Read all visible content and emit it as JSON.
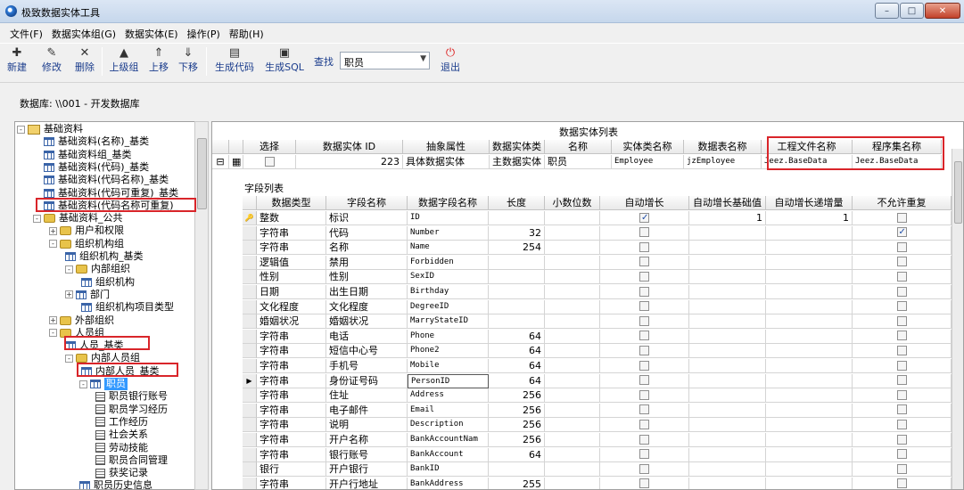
{
  "window": {
    "title": "极致数据实体工具"
  },
  "menu": [
    "文件(F)",
    "数据实体组(G)",
    "数据实体(E)",
    "操作(P)",
    "帮助(H)"
  ],
  "toolbar": {
    "new": "新建",
    "edit": "修改",
    "delete": "删除",
    "parent_group": "上级组",
    "move_up": "上移",
    "move_down": "下移",
    "gen_code": "生成代码",
    "gen_sql": "生成SQL",
    "find_label": "查找",
    "find_value": "职员",
    "exit": "退出"
  },
  "db_label": "数据库: \\\\001 - 开发数据库",
  "tree": [
    {
      "label": "基础资料",
      "icon": "root-icon",
      "exp": "-"
    },
    {
      "label": "基础资料(名称)_基类",
      "icon": "table-icon"
    },
    {
      "label": "基础资料组_基类",
      "icon": "table-icon"
    },
    {
      "label": "基础资料(代码)_基类",
      "icon": "table-icon"
    },
    {
      "label": "基础资料(代码名称)_基类",
      "icon": "table-icon"
    },
    {
      "label": "基础资料(代码可重复)_基类",
      "icon": "table-icon"
    },
    {
      "label": "基础资料(代码名称可重复)_",
      "icon": "table-icon"
    },
    {
      "label": "基础资料_公共",
      "icon": "folder-icon",
      "exp": "-"
    },
    {
      "label": "用户和权限",
      "icon": "folder-icon",
      "exp": "+"
    },
    {
      "label": "组织机构组",
      "icon": "folder-icon",
      "exp": "-"
    },
    {
      "label": "组织机构_基类",
      "icon": "table-icon"
    },
    {
      "label": "内部组织",
      "icon": "folder-icon",
      "exp": "-"
    },
    {
      "label": "组织机构",
      "icon": "table-icon"
    },
    {
      "label": "部门",
      "icon": "table-icon",
      "exp": "+"
    },
    {
      "label": "组织机构项目类型",
      "icon": "table-icon"
    },
    {
      "label": "外部组织",
      "icon": "folder-icon",
      "exp": "+"
    },
    {
      "label": "人员组",
      "icon": "folder-icon",
      "exp": "-"
    },
    {
      "label": "人员_基类",
      "icon": "table-icon"
    },
    {
      "label": "内部人员组",
      "icon": "folder-icon",
      "exp": "-"
    },
    {
      "label": "内部人员_基类",
      "icon": "table-icon"
    },
    {
      "label": "职员",
      "icon": "table-icon",
      "exp": "-"
    },
    {
      "label": "职员银行账号",
      "icon": "form-icon"
    },
    {
      "label": "职员学习经历",
      "icon": "form-icon"
    },
    {
      "label": "工作经历",
      "icon": "form-icon"
    },
    {
      "label": "社会关系",
      "icon": "form-icon"
    },
    {
      "label": "劳动技能",
      "icon": "form-icon"
    },
    {
      "label": "职员合同管理",
      "icon": "form-icon"
    },
    {
      "label": "获奖记录",
      "icon": "form-icon"
    },
    {
      "label": "职员历史信息",
      "icon": "table-icon"
    }
  ],
  "entity_grid": {
    "title": "数据实体列表",
    "headers": [
      "选择",
      "数据实体 ID",
      "抽象属性",
      "数据实体类",
      "名称",
      "实体类名称",
      "数据表名称",
      "工程文件名称",
      "程序集名称"
    ],
    "row": {
      "id": "223",
      "abstract": "具体数据实体",
      "entity_class": "主数据实体",
      "name": "职员",
      "class_name": "Employee",
      "table_name": "jzEmployee",
      "project_file": "Jeez.BaseData",
      "assembly": "Jeez.BaseData"
    }
  },
  "field_grid": {
    "title": "字段列表",
    "headers": [
      "数据类型",
      "字段名称",
      "数据字段名称",
      "长度",
      "小数位数",
      "自动增长",
      "自动增长基础值",
      "自动增长递增量",
      "不允许重复"
    ],
    "rows": [
      {
        "type": "整数",
        "name": "标识",
        "field": "ID",
        "len": "",
        "auto": true,
        "seed": "1",
        "step": "1",
        "uniq": false,
        "key": true
      },
      {
        "type": "字符串",
        "name": "代码",
        "field": "Number",
        "len": "32",
        "auto": false,
        "seed": "",
        "step": "",
        "uniq": true
      },
      {
        "type": "字符串",
        "name": "名称",
        "field": "Name",
        "len": "254",
        "auto": false,
        "seed": "",
        "step": "",
        "uniq": false
      },
      {
        "type": "逻辑值",
        "name": "禁用",
        "field": "Forbidden",
        "len": "",
        "auto": false,
        "seed": "",
        "step": "",
        "uniq": false
      },
      {
        "type": "性别",
        "name": "性别",
        "field": "SexID",
        "len": "",
        "auto": false,
        "seed": "",
        "step": "",
        "uniq": false
      },
      {
        "type": "日期",
        "name": "出生日期",
        "field": "Birthday",
        "len": "",
        "auto": false,
        "seed": "",
        "step": "",
        "uniq": false
      },
      {
        "type": "文化程度",
        "name": "文化程度",
        "field": "DegreeID",
        "len": "",
        "auto": false,
        "seed": "",
        "step": "",
        "uniq": false
      },
      {
        "type": "婚姻状况",
        "name": "婚姻状况",
        "field": "MarryStateID",
        "len": "",
        "auto": false,
        "seed": "",
        "step": "",
        "uniq": false
      },
      {
        "type": "字符串",
        "name": "电话",
        "field": "Phone",
        "len": "64",
        "auto": false,
        "seed": "",
        "step": "",
        "uniq": false
      },
      {
        "type": "字符串",
        "name": "短信中心号",
        "field": "Phone2",
        "len": "64",
        "auto": false,
        "seed": "",
        "step": "",
        "uniq": false
      },
      {
        "type": "字符串",
        "name": "手机号",
        "field": "Mobile",
        "len": "64",
        "auto": false,
        "seed": "",
        "step": "",
        "uniq": false
      },
      {
        "type": "字符串",
        "name": "身份证号码",
        "field": "PersonID",
        "len": "64",
        "auto": false,
        "seed": "",
        "step": "",
        "uniq": false,
        "current": true
      },
      {
        "type": "字符串",
        "name": "住址",
        "field": "Address",
        "len": "256",
        "auto": false,
        "seed": "",
        "step": "",
        "uniq": false
      },
      {
        "type": "字符串",
        "name": "电子邮件",
        "field": "Email",
        "len": "256",
        "auto": false,
        "seed": "",
        "step": "",
        "uniq": false
      },
      {
        "type": "字符串",
        "name": "说明",
        "field": "Description",
        "len": "256",
        "auto": false,
        "seed": "",
        "step": "",
        "uniq": false
      },
      {
        "type": "字符串",
        "name": "开户名称",
        "field": "BankAccountNam",
        "len": "256",
        "auto": false,
        "seed": "",
        "step": "",
        "uniq": false
      },
      {
        "type": "字符串",
        "name": "银行账号",
        "field": "BankAccount",
        "len": "64",
        "auto": false,
        "seed": "",
        "step": "",
        "uniq": false
      },
      {
        "type": "银行",
        "name": "开户银行",
        "field": "BankID",
        "len": "",
        "auto": false,
        "seed": "",
        "step": "",
        "uniq": false
      },
      {
        "type": "字符串",
        "name": "开户行地址",
        "field": "BankAddress",
        "len": "255",
        "auto": false,
        "seed": "",
        "step": "",
        "uniq": false
      }
    ]
  }
}
